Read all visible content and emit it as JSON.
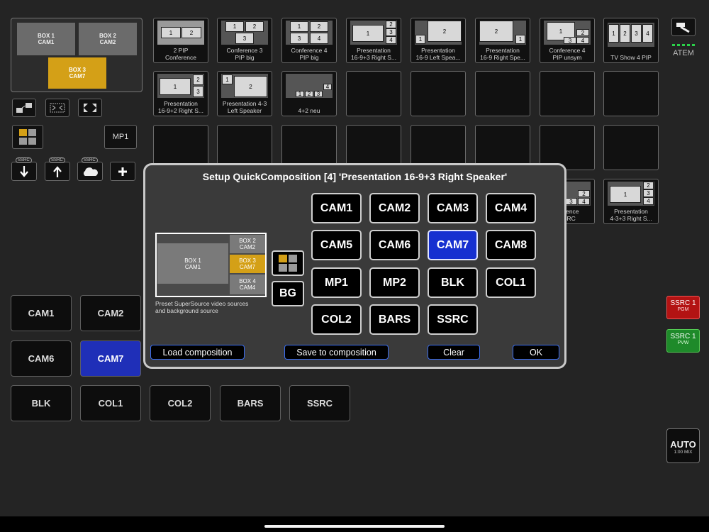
{
  "preview": {
    "box1": "BOX 1\nCAM1",
    "box2": "BOX 2\nCAM2",
    "box3": "BOX 3\nCAM7"
  },
  "left_tools": {
    "mp1_label": "MP1",
    "ssrc_tags": [
      "SSRC",
      "SSRC",
      "SSRC"
    ]
  },
  "compositions": [
    {
      "caption": "2 PIP\nConference",
      "cells": [
        "1",
        "2"
      ]
    },
    {
      "caption": "Conference 3\nPIP big",
      "cells": [
        "1",
        "2",
        "3"
      ]
    },
    {
      "caption": "Conference 4\nPIP big",
      "cells": [
        "1",
        "2",
        "3",
        "4"
      ]
    },
    {
      "caption": "Presentation\n16-9+3 Right S...",
      "cells": [
        "1",
        "2",
        "3",
        "4"
      ]
    },
    {
      "caption": "Presentation\n16-9 Left Spea...",
      "cells": [
        "1",
        "2"
      ]
    },
    {
      "caption": "Presentation\n16-9 Right Spe...",
      "cells": [
        "2",
        "1"
      ]
    },
    {
      "caption": "Conference 4\nPIP unsym",
      "cells": [
        "1",
        "2",
        "3",
        "4"
      ]
    },
    {
      "caption": "TV Show 4 PIP",
      "cells": [
        "1",
        "2",
        "3",
        "4"
      ]
    },
    {
      "caption": "Presentation\n16-9+2 Right S...",
      "cells": [
        "1",
        "2",
        "3"
      ]
    },
    {
      "caption": "Presentation 4-3\nLeft Speaker",
      "cells": [
        "1",
        "2"
      ]
    },
    {
      "caption": "4+2 neu",
      "cells": [
        "1",
        "2",
        "3",
        "4"
      ]
    },
    {
      "caption": "...erence\nSSRC",
      "cells": [
        "2",
        "3",
        "4"
      ]
    },
    {
      "caption": "Presentation\n4-3+3 Right S...",
      "cells": [
        "1",
        "2",
        "3",
        "4"
      ]
    }
  ],
  "atem_label": "ATEM",
  "sources": {
    "row1": [
      "CAM1",
      "CAM2"
    ],
    "row2": [
      "CAM6",
      "CAM7"
    ],
    "row3": [
      "BLK",
      "COL1",
      "COL2",
      "BARS",
      "SSRC"
    ]
  },
  "right": {
    "pgm_title": "SSRC 1",
    "pgm_sub": "PGM",
    "pvw_title": "SSRC 1",
    "pvw_sub": "PVW",
    "auto_title": "AUTO",
    "auto_sub": "1:00 MIX"
  },
  "dialog": {
    "title": "Setup QuickComposition [4] 'Presentation 16-9+3 Right Speaker'",
    "preview": {
      "box1": "BOX 1\nCAM1",
      "box2": "BOX 2\nCAM2",
      "box3": "BOX 3\nCAM7",
      "box4": "BOX 4\nCAM4"
    },
    "bg_label": "BG",
    "preset_text": "Preset SuperSource video sources\nand background source",
    "sources": [
      "CAM1",
      "CAM2",
      "CAM3",
      "CAM4",
      "CAM5",
      "CAM6",
      "CAM7",
      "CAM8",
      "MP1",
      "MP2",
      "BLK",
      "COL1",
      "COL2",
      "BARS",
      "SSRC"
    ],
    "selected": "CAM7",
    "actions": {
      "load": "Load composition",
      "save": "Save to composition",
      "clear": "Clear",
      "ok": "OK"
    }
  },
  "colors": {
    "accent_blue": "#1630d0",
    "box_gold": "#d4a017",
    "pgm_red": "#b31313",
    "pvw_green": "#1e8a2a"
  }
}
